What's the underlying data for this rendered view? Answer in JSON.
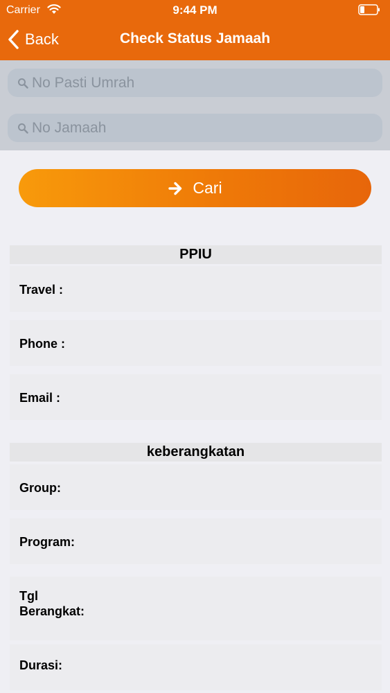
{
  "status_bar": {
    "carrier": "Carrier",
    "time": "9:44 PM"
  },
  "nav": {
    "back_label": "Back",
    "title": "Check Status Jamaah"
  },
  "search": {
    "no_pasti_placeholder": "No Pasti Umrah",
    "no_jamaah_placeholder": "No Jamaah"
  },
  "cari_button": {
    "label": "Cari",
    "icon": "arrow-right-icon"
  },
  "ppiu": {
    "header": "PPIU",
    "fields": {
      "travel": "Travel :",
      "phone": "Phone :",
      "email": "Email :"
    }
  },
  "keberangkatan": {
    "header": "keberangkatan",
    "fields": {
      "group": "Group:",
      "program": "Program:",
      "tgl_line1": "Tgl",
      "tgl_line2": "Berangkat:",
      "durasi": "Durasi:"
    }
  },
  "colors": {
    "accent": "#e8690c",
    "button_start": "#f89a0b",
    "button_end": "#e7660a",
    "background": "#efeff4",
    "search_area": "#c9cdd4"
  }
}
